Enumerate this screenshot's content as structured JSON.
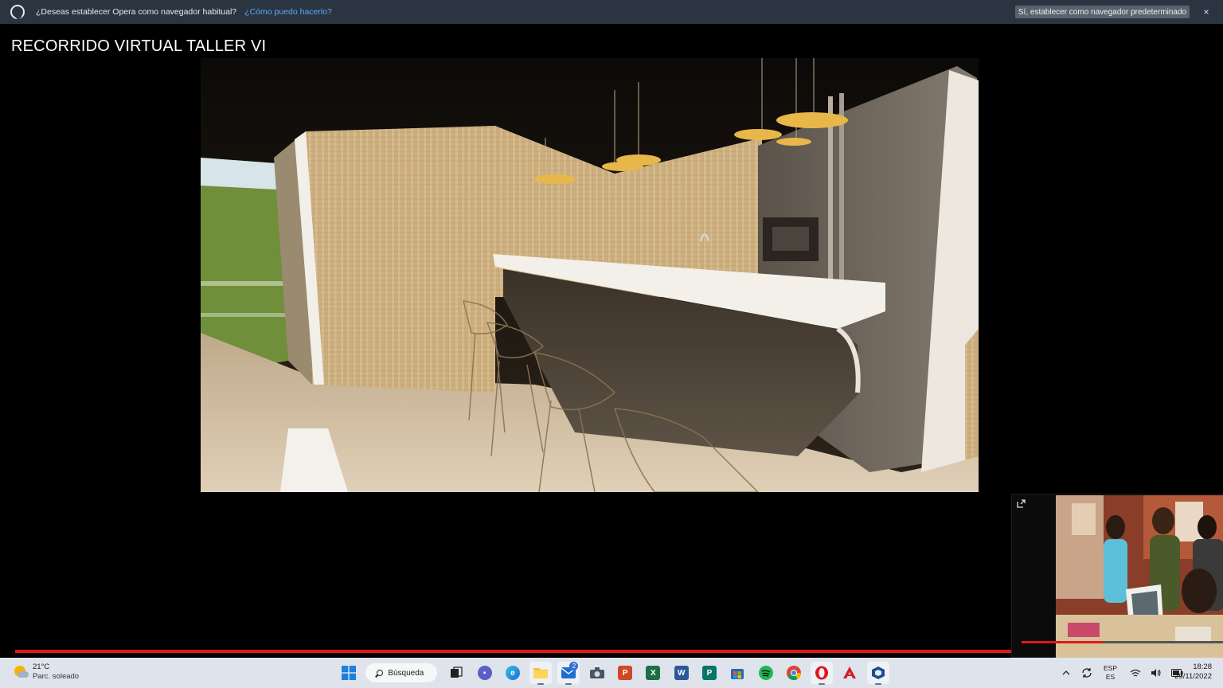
{
  "opera_bar": {
    "message": "¿Deseas establecer Opera como navegador habitual?",
    "link": "¿Cómo puedo hacerlo?",
    "action": "Sí, establecer como navegador predeterminado",
    "close": "×"
  },
  "page": {
    "title": "RECORRIDO VIRTUAL TALLER VI"
  },
  "player": {
    "progress": 1.0,
    "pip_progress": 0.4
  },
  "taskbar": {
    "weather": {
      "temp": "21°C",
      "desc": "Parc. soleado"
    },
    "search_label": "Búsqueda",
    "mail_badge": "2",
    "language": {
      "top": "ESP",
      "bottom": "ES"
    },
    "clock": {
      "time": "18:28",
      "date": "29/11/2022"
    }
  },
  "colors": {
    "opera_bar_bg": "#2b3541",
    "link_blue": "#5fa8ff",
    "progress_red": "#e01818",
    "taskbar_bg": "#dfe4ec"
  },
  "icons": [
    "windows-start-icon",
    "search-icon",
    "task-view-icon",
    "teams-chat-icon",
    "edge-icon",
    "file-explorer-icon",
    "mail-icon",
    "camera-icon",
    "powerpoint-icon",
    "excel-icon",
    "word-icon",
    "publisher-icon",
    "microsoft-store-icon",
    "spotify-icon",
    "chrome-icon",
    "opera-icon",
    "acrobat-icon",
    "sketchup-icon",
    "chevron-up-icon",
    "sync-icon",
    "wifi-icon",
    "volume-icon",
    "battery-icon"
  ]
}
